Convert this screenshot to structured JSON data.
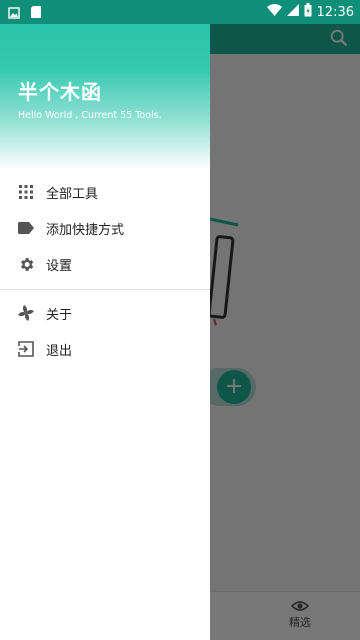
{
  "status_bar": {
    "time": "12:36",
    "left_icons": [
      "image-notification-icon",
      "sd-card-notification-icon"
    ],
    "right_icons": [
      "wifi-icon",
      "signal-icon",
      "battery-icon"
    ]
  },
  "drawer": {
    "title": "半个木函",
    "subtitle": "Hello World , Current 55 Tools.",
    "menu": [
      {
        "label": "全部工具",
        "icon": "grid-icon"
      },
      {
        "label": "添加快捷方式",
        "icon": "label-tag-icon"
      },
      {
        "label": "设置",
        "icon": "gear-icon"
      }
    ],
    "menu_secondary": [
      {
        "label": "关于",
        "icon": "pinwheel-icon"
      },
      {
        "label": "退出",
        "icon": "exit-icon"
      }
    ]
  },
  "background_app": {
    "toolbar_icon": "search-icon",
    "fab_label": "+",
    "bottom_nav": [
      {
        "label": "精选",
        "icon": "eye-icon"
      }
    ]
  },
  "colors": {
    "accent": "#1fb39b",
    "status_bar": "#0f8e78",
    "scrim": "rgba(0,0,0,0.52)"
  }
}
